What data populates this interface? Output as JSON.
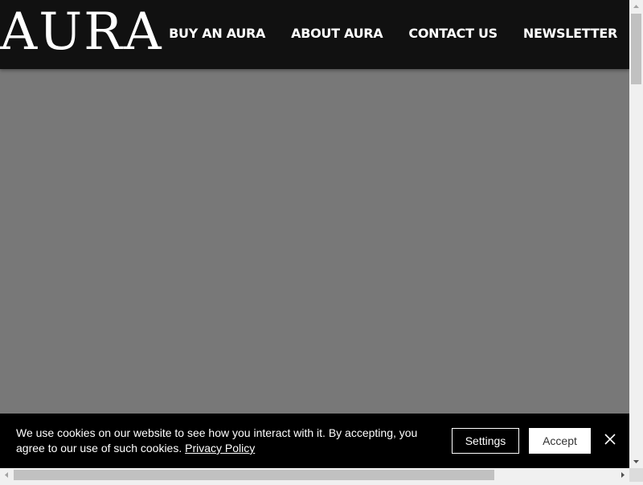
{
  "brand": {
    "logo_text": "AURA"
  },
  "nav": {
    "items": [
      {
        "label": "BUY AN AURA"
      },
      {
        "label": "ABOUT AURA"
      },
      {
        "label": "CONTACT US"
      },
      {
        "label": "NEWSLETTER"
      }
    ]
  },
  "cookie_banner": {
    "message": "We use cookies on our website to see how you interact with it. By accepting, you agree to our use of such cookies.",
    "policy_link": "Privacy Policy",
    "settings_label": "Settings",
    "accept_label": "Accept"
  },
  "colors": {
    "header_bg": "#111111",
    "hero_bg": "#787878",
    "banner_bg": "#000000"
  }
}
